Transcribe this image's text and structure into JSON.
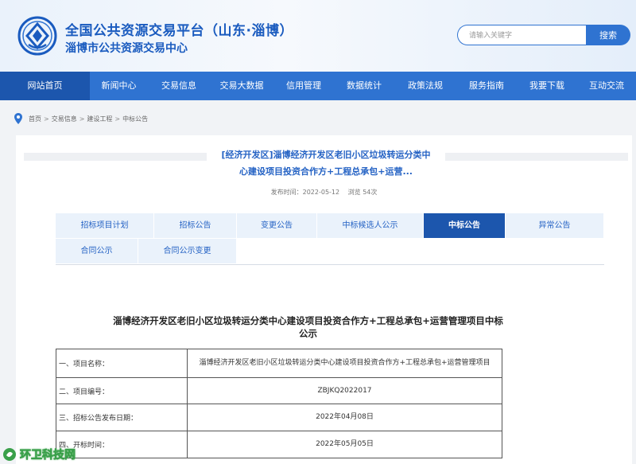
{
  "header": {
    "title": "全国公共资源交易平台（山东·淄博）",
    "subtitle": "淄博市公共资源交易中心",
    "search_placeholder": "请输入关键字",
    "search_button": "搜索"
  },
  "nav": {
    "items": [
      "网站首页",
      "新闻中心",
      "交易信息",
      "交易大数据",
      "信用管理",
      "数据统计",
      "政策法规",
      "服务指南",
      "我要下载",
      "互动交流"
    ],
    "active_index": 0
  },
  "breadcrumb": [
    "首页",
    "交易信息",
    "建设工程",
    "中标公告"
  ],
  "article": {
    "title_line1": "[经济开发区]淄博经济开发区老旧小区垃圾转运分类中",
    "title_line2": "心建设项目投资合作方+工程总承包+运营...",
    "publish_label": "发布时间：2022-05-12",
    "views_label": "浏览 54次"
  },
  "tabs": {
    "row1": [
      "招标项目计划",
      "招标公告",
      "变更公告",
      "中标候选人公示",
      "中标公告",
      "异常公告"
    ],
    "row2": [
      "合同公示",
      "合同公示变更"
    ],
    "active": "中标公告"
  },
  "doc": {
    "title_line1": "淄博经济开发区老旧小区垃圾转运分类中心建设项目投资合作方+工程总承包+运营管理项目中标",
    "title_line2": "公示",
    "rows": [
      {
        "key": "一、项目名称：",
        "value": "淄博经济开发区老旧小区垃圾转运分类中心建设项目投资合作方+工程总承包+运营管理项目"
      },
      {
        "key": "二、项目编号：",
        "value": "ZBJKQ2022017"
      },
      {
        "key": "三、招标公告发布日期：",
        "value": "2022年04月08日"
      },
      {
        "key": "四、开标时间：",
        "value": "2022年05月05日"
      }
    ]
  },
  "watermark": {
    "text": "环卫科技网"
  },
  "colors": {
    "primary": "#2f73d1",
    "nav_active": "#1c56ad",
    "title_blue": "#2462c4"
  }
}
